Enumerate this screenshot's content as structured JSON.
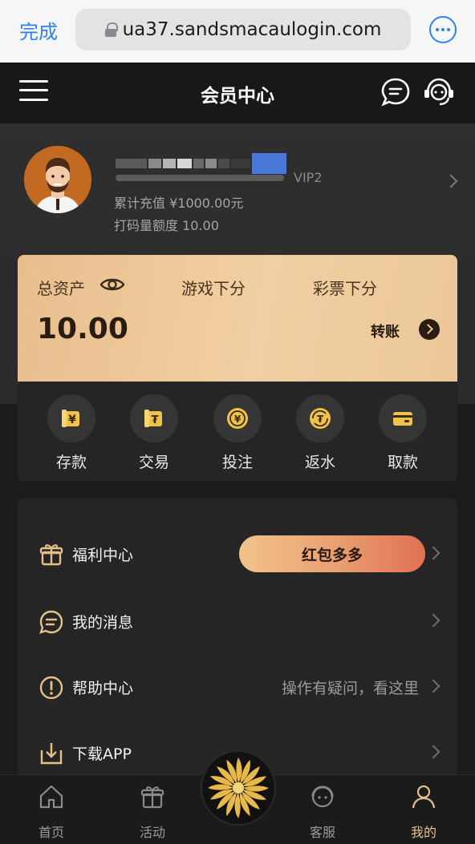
{
  "browser": {
    "done": "完成",
    "url": "ua37.sandsmacaulogin.com"
  },
  "header": {
    "title": "会员中心"
  },
  "profile": {
    "vip": "VIP2",
    "recharge": "累计充值 ¥1000.00元",
    "wager": "打码量额度 10.00"
  },
  "assets": {
    "total_label": "总资产",
    "total_value": "10.00",
    "game_label": "游戏下分",
    "lottery_label": "彩票下分",
    "transfer_label": "转账"
  },
  "actions": [
    {
      "label": "存款",
      "icon": "deposit-icon"
    },
    {
      "label": "交易",
      "icon": "trade-icon"
    },
    {
      "label": "投注",
      "icon": "bet-icon"
    },
    {
      "label": "返水",
      "icon": "rebate-icon"
    },
    {
      "label": "取款",
      "icon": "withdraw-icon"
    }
  ],
  "menu": {
    "welfare": {
      "label": "福利中心",
      "button": "红包多多"
    },
    "messages": {
      "label": "我的消息"
    },
    "help": {
      "label": "帮助中心",
      "hint": "操作有疑问，看这里"
    },
    "download": {
      "label": "下载APP"
    }
  },
  "tabs": [
    {
      "label": "首页",
      "icon": "home-icon"
    },
    {
      "label": "活动",
      "icon": "gift-icon"
    },
    {
      "label": "客服",
      "icon": "service-icon"
    },
    {
      "label": "我的",
      "icon": "user-icon",
      "active": true
    }
  ],
  "colors": {
    "accent_gold": "#e6c08a",
    "browser_blue": "#2f7ff6",
    "background": "#1c1c1c"
  }
}
